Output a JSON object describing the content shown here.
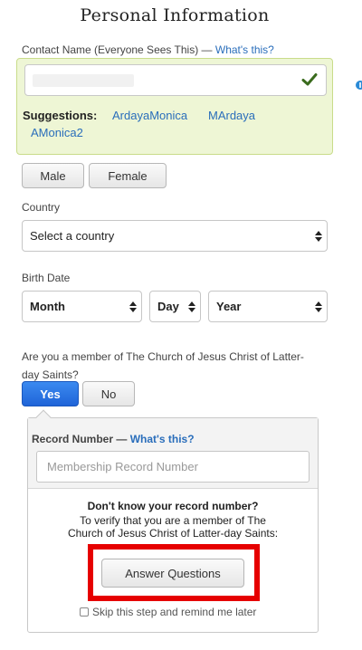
{
  "page_title": "Personal Information",
  "contact_name": {
    "label": "Contact Name (Everyone Sees This) — ",
    "help_link": "What's this?",
    "value": "",
    "suggestions_label": "Suggestions:",
    "suggestions": [
      "ArdayaMonica",
      "MArdaya",
      "AMonica2"
    ]
  },
  "gender": {
    "male_label": "Male",
    "female_label": "Female"
  },
  "country": {
    "label": "Country",
    "selected": "Select a country"
  },
  "birth_date": {
    "label": "Birth Date",
    "month": "Month",
    "day": "Day",
    "year": "Year"
  },
  "membership": {
    "question_line1": "Are you a member of The Church of Jesus Christ of Latter-",
    "question_line2": "day Saints?",
    "yes_label": "Yes",
    "no_label": "No",
    "selected": "Yes"
  },
  "record": {
    "label": "Record Number — ",
    "help_link": "What's this?",
    "placeholder": "Membership Record Number",
    "help_title": "Don't know your record number?",
    "help_line1": "To verify that you are a member of The",
    "help_line2": "Church of Jesus Christ of Latter-day Saints:",
    "answer_button": "Answer Questions",
    "skip_label": "Skip this step and remind me later"
  },
  "colors": {
    "accent": "#1f64d8",
    "link": "#2a6ebb",
    "highlight": "#e60000",
    "suggestion_bg": "#eef6d5",
    "check": "#3a6b1d"
  }
}
